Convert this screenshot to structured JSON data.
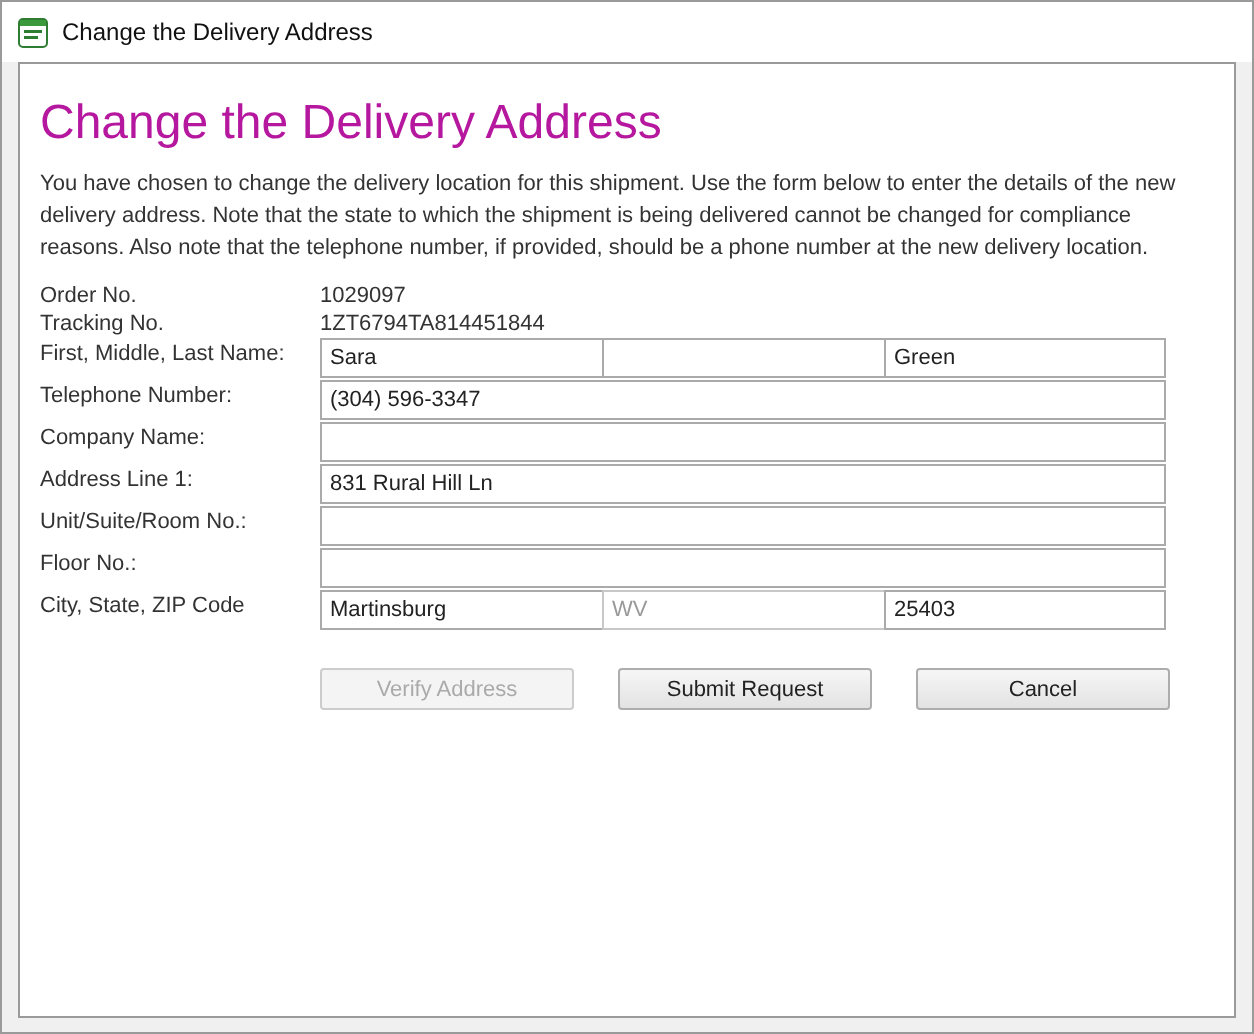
{
  "window": {
    "title": "Change the Delivery Address"
  },
  "heading": "Change the Delivery Address",
  "intro": "You have chosen to change the delivery location for this shipment. Use the form below to enter the details of the new delivery address. Note that the state to which the shipment is being delivered cannot be changed for compliance reasons. Also note that the telephone number, if provided, should be a phone number at the new delivery location.",
  "info": [
    {
      "label": "Order No.",
      "value": "1029097"
    },
    {
      "label": "Tracking No.",
      "value": "1ZT6794TA814451844"
    }
  ],
  "fields": [
    {
      "label": "First, Middle, Last Name:",
      "inputs": [
        {
          "value": "Sara",
          "disabled": false
        },
        {
          "disabled": false
        },
        {
          "value": "Green",
          "disabled": false
        }
      ]
    },
    {
      "label": "Telephone Number:",
      "inputs": [
        {
          "value": "(304) 596-3347",
          "disabled": false
        }
      ]
    },
    {
      "label": "Company Name:",
      "inputs": [
        {
          "disabled": false
        }
      ]
    },
    {
      "label": "Address Line 1:",
      "inputs": [
        {
          "value": "831 Rural Hill Ln",
          "disabled": false
        }
      ]
    },
    {
      "label": "Unit/Suite/Room No.:",
      "inputs": [
        {
          "disabled": false
        }
      ]
    },
    {
      "label": "Floor No.:",
      "inputs": [
        {
          "disabled": false
        }
      ]
    },
    {
      "label": "City, State, ZIP Code",
      "inputs": [
        {
          "value": "Martinsburg",
          "disabled": false
        },
        {
          "value": "WV",
          "disabled": true
        },
        {
          "value": "25403",
          "disabled": false
        }
      ]
    }
  ],
  "buttons": [
    {
      "label": "Verify Address",
      "disabled": true
    },
    {
      "label": "Submit Request",
      "disabled": false
    },
    {
      "label": "Cancel",
      "disabled": false
    }
  ]
}
